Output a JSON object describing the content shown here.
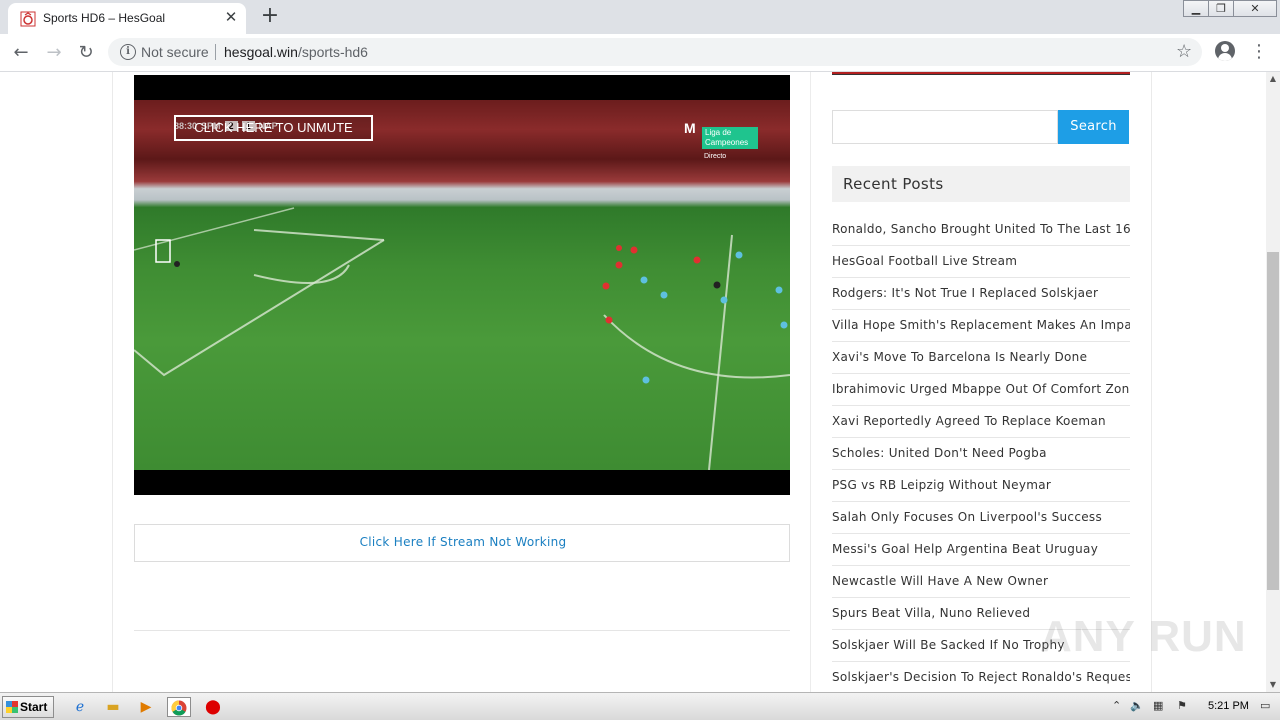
{
  "browser": {
    "tab_title": "Sports HD6 – HesGoal",
    "security_label": "Not secure",
    "url_host": "hesgoal.win",
    "url_path": "/sports-hd6"
  },
  "player": {
    "unmute_label": "CLICK HERE TO UNMUTE",
    "score_time": "88:30",
    "score_home": "SPM",
    "score_home_goals": "2",
    "score_away_goals": "1",
    "score_away": "NAP",
    "channel_name": "Liga de Campeones",
    "channel_status": "Directo"
  },
  "content": {
    "stream_link": "Click Here If Stream Not Working"
  },
  "sidebar": {
    "search_button": "Search",
    "recent_title": "Recent Posts",
    "posts": [
      "Ronaldo, Sancho Brought United To The Last 16",
      "HesGoal Football Live Stream",
      "Rodgers: It's Not True I Replaced Solskjaer",
      "Villa Hope Smith's Replacement Makes An Impact",
      "Xavi's Move To Barcelona Is Nearly Done",
      "Ibrahimovic Urged Mbappe Out Of Comfort Zone",
      "Xavi Reportedly Agreed To Replace Koeman",
      "Scholes: United Don't Need Pogba",
      "PSG vs RB Leipzig Without Neymar",
      "Salah Only Focuses On Liverpool's Success",
      "Messi's Goal Help Argentina Beat Uruguay",
      "Newcastle Will Have A New Owner",
      "Spurs Beat Villa, Nuno Relieved",
      "Solskjaer Will Be Sacked If No Trophy",
      "Solskjaer's Decision To Reject Ronaldo's Request"
    ]
  },
  "watermark": "ANY RUN",
  "taskbar": {
    "start_label": "Start",
    "clock": "5:21 PM"
  }
}
